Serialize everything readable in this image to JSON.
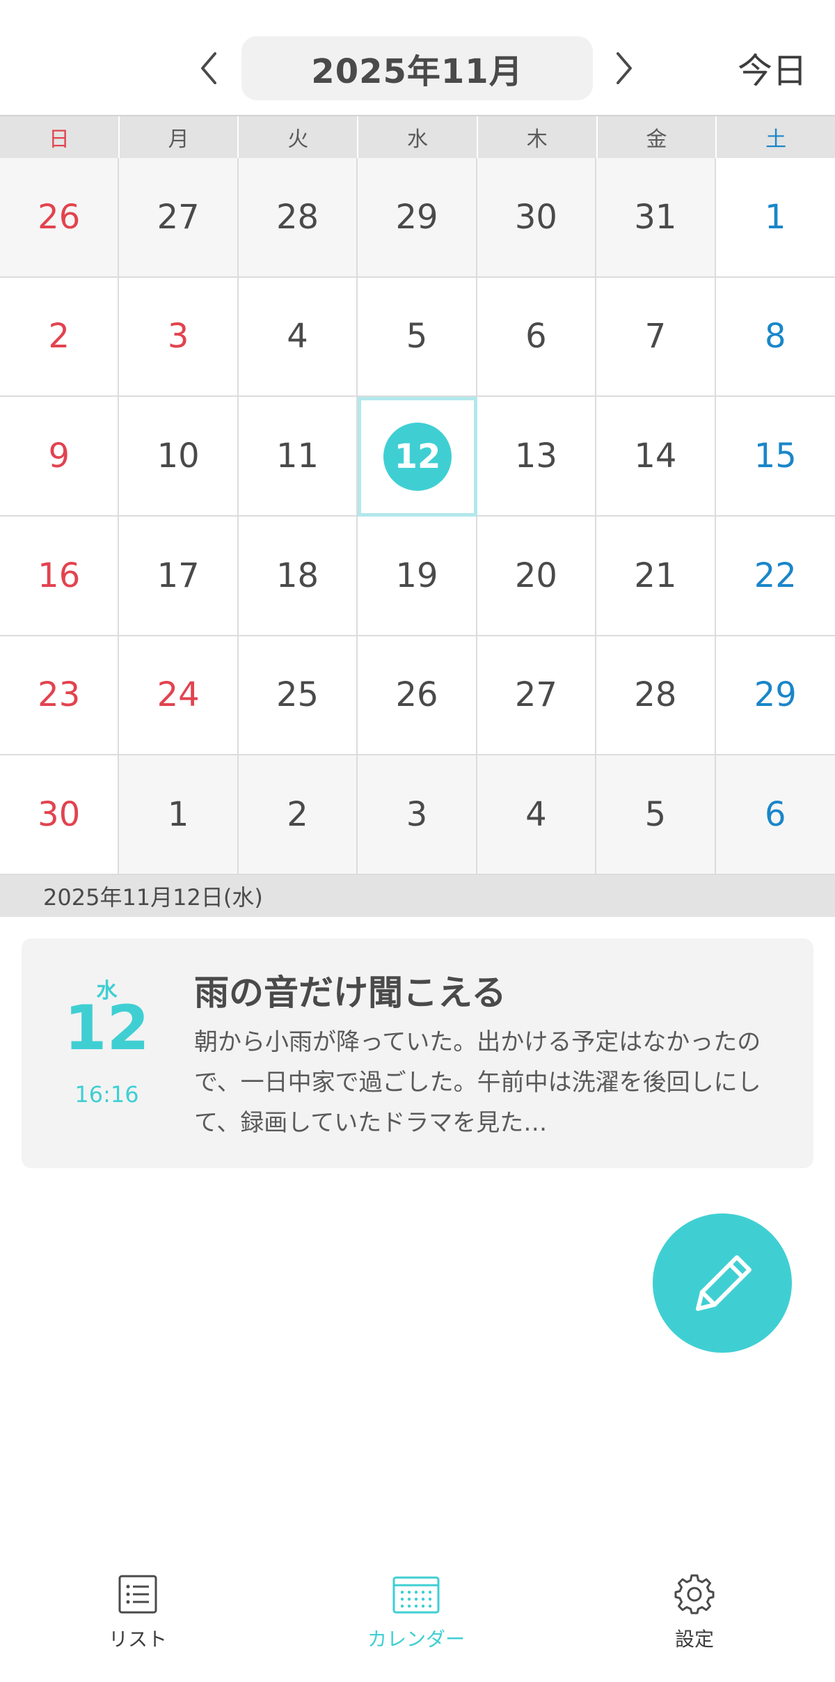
{
  "header": {
    "month_title": "2025年11月",
    "today_label": "今日"
  },
  "weekdays": [
    "日",
    "月",
    "火",
    "水",
    "木",
    "金",
    "土"
  ],
  "calendar": {
    "weeks": [
      [
        {
          "d": "26",
          "other": true
        },
        {
          "d": "27",
          "other": true
        },
        {
          "d": "28",
          "other": true
        },
        {
          "d": "29",
          "other": true
        },
        {
          "d": "30",
          "other": true
        },
        {
          "d": "31",
          "other": true
        },
        {
          "d": "1"
        }
      ],
      [
        {
          "d": "2",
          "holiday": false
        },
        {
          "d": "3",
          "holiday": true
        },
        {
          "d": "4"
        },
        {
          "d": "5"
        },
        {
          "d": "6"
        },
        {
          "d": "7"
        },
        {
          "d": "8"
        }
      ],
      [
        {
          "d": "9"
        },
        {
          "d": "10"
        },
        {
          "d": "11"
        },
        {
          "d": "12",
          "today": true
        },
        {
          "d": "13"
        },
        {
          "d": "14"
        },
        {
          "d": "15"
        }
      ],
      [
        {
          "d": "16"
        },
        {
          "d": "17"
        },
        {
          "d": "18"
        },
        {
          "d": "19"
        },
        {
          "d": "20"
        },
        {
          "d": "21"
        },
        {
          "d": "22"
        }
      ],
      [
        {
          "d": "23"
        },
        {
          "d": "24",
          "holiday": true
        },
        {
          "d": "25"
        },
        {
          "d": "26"
        },
        {
          "d": "27"
        },
        {
          "d": "28"
        },
        {
          "d": "29"
        }
      ],
      [
        {
          "d": "30"
        },
        {
          "d": "1",
          "other": true
        },
        {
          "d": "2",
          "other": true
        },
        {
          "d": "3",
          "other": true
        },
        {
          "d": "4",
          "other": true
        },
        {
          "d": "5",
          "other": true
        },
        {
          "d": "6",
          "other": true
        }
      ]
    ]
  },
  "selected_date_label": "2025年11月12日(水)",
  "entry": {
    "weekday": "水",
    "day": "12",
    "time": "16:16",
    "title": "雨の音だけ聞こえる",
    "body": "朝から小雨が降っていた。出かける予定はなかったので、一日中家で過ごした。午前中は洗濯を後回しにして、録画していたドラマを見た…"
  },
  "fab": {
    "icon": "pencil-icon"
  },
  "bottom_nav": {
    "list_label": "リスト",
    "calendar_label": "カレンダー",
    "settings_label": "設定"
  },
  "colors": {
    "accent": "#3fcfd3",
    "sunday": "#e2434f",
    "saturday": "#1a86c9",
    "selected_border": "#b2e8ec"
  }
}
